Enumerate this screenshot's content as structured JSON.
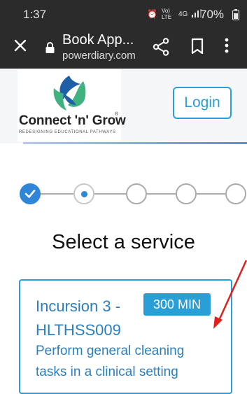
{
  "status_bar": {
    "time": "1:37",
    "indicators": [
      "alarm-icon",
      "volte-icon",
      "4g-icon",
      "signal-icon"
    ],
    "vo_lte_label": "Vo) LTE",
    "net_label": "4G",
    "battery": "70%"
  },
  "browser": {
    "page_title": "Book App...",
    "url": "powerdiary.com"
  },
  "header": {
    "brand_name": "Connect 'n' Grow",
    "tagline": "REDESIGNING EDUCATIONAL PATHWAYS",
    "login_label": "Login",
    "colors": {
      "accent": "#2a9ed7",
      "logo_green": "#3fb27f",
      "logo_blue": "#1f5fa8"
    }
  },
  "stepper": {
    "steps": [
      {
        "state": "complete"
      },
      {
        "state": "current"
      },
      {
        "state": "upcoming"
      },
      {
        "state": "upcoming"
      },
      {
        "state": "upcoming"
      }
    ]
  },
  "main": {
    "heading": "Select a service",
    "services": [
      {
        "name": "Incursion 3 - HLTHSS009",
        "duration": "300 MIN",
        "description": "Perform general cleaning tasks in a clinical setting"
      }
    ]
  },
  "annotation": {
    "arrow_color": "#e0201c"
  }
}
